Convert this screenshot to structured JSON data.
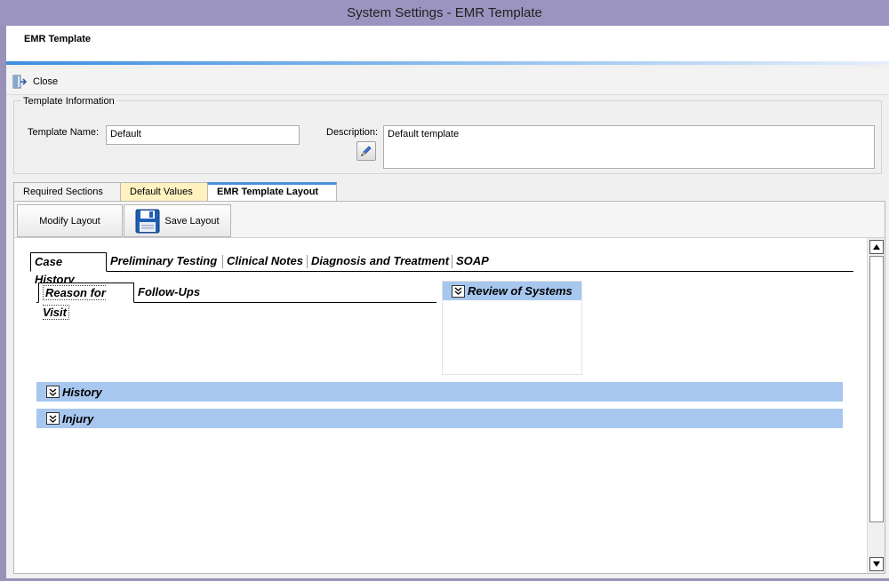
{
  "window": {
    "title": "System Settings - EMR Template"
  },
  "header": {
    "title": "EMR Template"
  },
  "toolbar": {
    "close_label": "Close"
  },
  "template_info": {
    "legend": "Template Information",
    "name_label": "Template Name:",
    "name_value": "Default",
    "description_label": "Description:",
    "description_value": "Default template"
  },
  "tabs": [
    {
      "label": "Required Sections",
      "active": false
    },
    {
      "label": "Default Values",
      "active": false,
      "color": "#fff2c0"
    },
    {
      "label": "EMR Template Layout",
      "active": true
    }
  ],
  "layout_toolbar": {
    "modify_label": "Modify Layout",
    "save_label": "Save Layout"
  },
  "layout_tabs": [
    {
      "label": "Case History",
      "active": true
    },
    {
      "label": "Preliminary Testing",
      "active": false
    },
    {
      "label": "Clinical Notes",
      "active": false
    },
    {
      "label": "Diagnosis and Treatment",
      "active": false
    },
    {
      "label": "SOAP",
      "active": false
    }
  ],
  "sub_tabs": [
    {
      "label": "Reason for Visit",
      "active": true
    },
    {
      "label": "Follow-Ups",
      "active": false
    }
  ],
  "sections": {
    "review_of_systems": "Review of Systems",
    "history": "History",
    "injury": "Injury"
  },
  "colors": {
    "section_header": "#a7c7ef",
    "accent": "#4a90d9"
  }
}
